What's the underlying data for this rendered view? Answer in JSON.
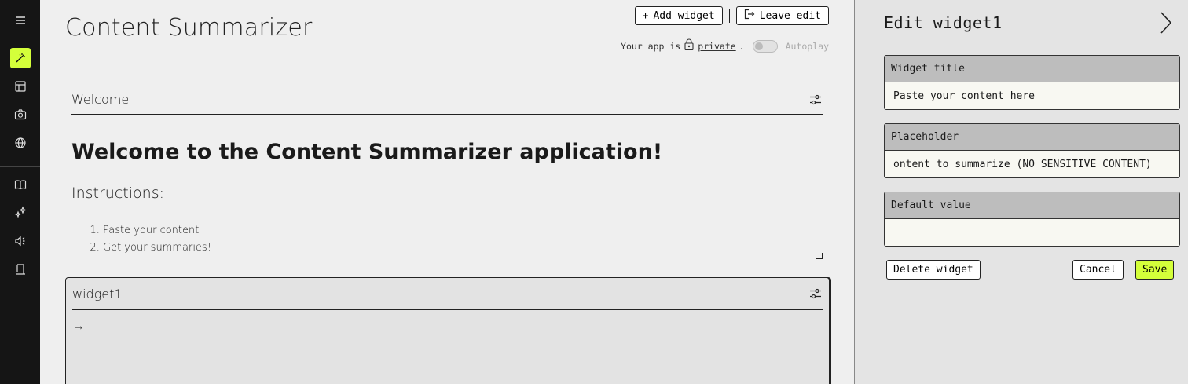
{
  "app": {
    "title": "Content Summarizer"
  },
  "toolbar": {
    "add_widget_label": "Add widget",
    "leave_edit_label": "Leave edit"
  },
  "status": {
    "prefix": "Your app is",
    "visibility": "private",
    "suffix": ".",
    "autoplay_label": "Autoplay",
    "autoplay_on": false
  },
  "nav": {
    "items": [
      {
        "icon": "menu-icon"
      },
      {
        "icon": "magic-wand-icon",
        "active": true
      },
      {
        "icon": "layout-icon"
      },
      {
        "icon": "camera-icon"
      },
      {
        "icon": "globe-icon"
      },
      {
        "icon": "book-icon"
      },
      {
        "icon": "sparkles-icon"
      },
      {
        "icon": "speaker-icon"
      },
      {
        "icon": "exit-icon"
      }
    ],
    "accent_color": "#d4ff3a"
  },
  "widgets": [
    {
      "title": "Welcome",
      "heading": "Welcome to the Content Summarizer application!",
      "subheading": "Instructions:",
      "list": [
        "Paste your content",
        "Get your summaries!"
      ]
    },
    {
      "title": "widget1",
      "arrow": "→"
    }
  ],
  "panel": {
    "title": "Edit widget1",
    "fields": [
      {
        "label": "Widget title",
        "value": "Paste your content here"
      },
      {
        "label": "Placeholder",
        "value": "ontent to summarize (NO SENSITIVE CONTENT)"
      },
      {
        "label": "Default value",
        "value": ""
      }
    ],
    "delete_label": "Delete widget",
    "cancel_label": "Cancel",
    "save_label": "Save"
  }
}
